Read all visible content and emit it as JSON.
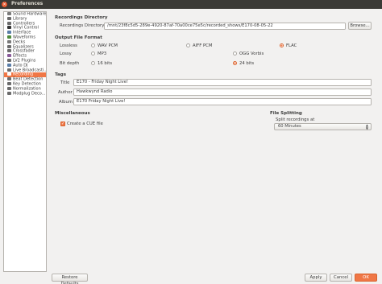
{
  "window": {
    "title": "Preferences"
  },
  "sidebar": {
    "items": [
      {
        "label": "Sound Hardware",
        "icon": "speaker-icon",
        "color": "#7a7a7a"
      },
      {
        "label": "Library",
        "icon": "library-icon",
        "color": "#6b6b6b"
      },
      {
        "label": "Controllers",
        "icon": "controller-icon",
        "color": "#6b6b6b"
      },
      {
        "label": "Vinyl Control",
        "icon": "vinyl-icon",
        "color": "#333333"
      },
      {
        "label": "Interface",
        "icon": "interface-icon",
        "color": "#5a7ea8"
      },
      {
        "label": "Waveforms",
        "icon": "waveform-icon",
        "color": "#4c8a3a"
      },
      {
        "label": "Decks",
        "icon": "deck-icon",
        "color": "#7a7a7a"
      },
      {
        "label": "Equalizers",
        "icon": "equalizer-icon",
        "color": "#6b6b6b"
      },
      {
        "label": "Crossfader",
        "icon": "crossfader-icon",
        "color": "#6b6b6b"
      },
      {
        "label": "Effects",
        "icon": "effects-icon",
        "color": "#8a5a9a"
      },
      {
        "label": "LV2 Plugins",
        "icon": "plugin-icon",
        "color": "#6b6b6b"
      },
      {
        "label": "Auto DJ",
        "icon": "autodj-icon",
        "color": "#5a7ea8"
      },
      {
        "label": "Live Broadcasti...",
        "icon": "broadcast-icon",
        "color": "#6b6b6b"
      },
      {
        "label": "Recording",
        "icon": "recording-icon",
        "color": "#ffffff",
        "selected": true
      },
      {
        "label": "Beat Detection",
        "icon": "beat-icon",
        "color": "#6b6b6b"
      },
      {
        "label": "Key Detection",
        "icon": "key-icon",
        "color": "#6b6b6b"
      },
      {
        "label": "Normalization",
        "icon": "normalization-icon",
        "color": "#6b6b6b"
      },
      {
        "label": "Modplug Deco...",
        "icon": "modplug-icon",
        "color": "#6b6b6b"
      }
    ]
  },
  "recordings_dir": {
    "title": "Recordings Directory",
    "label": "Recordings Directory:",
    "value": "/mnt/23f8c5d5-289e-4920-87af-70a00ce75e5c/recorded_shows/E170-08-05-22",
    "browse_label": "Browse..."
  },
  "output_format": {
    "title": "Output File Format",
    "lossless_label": "Lossless",
    "lossy_label": "Lossy",
    "bitdepth_label": "Bit depth",
    "options": {
      "wav": {
        "label": "WAV PCM",
        "checked": false
      },
      "aiff": {
        "label": "AIFF PCM",
        "checked": false
      },
      "flac": {
        "label": "FLAC",
        "checked": true
      },
      "mp3": {
        "label": "MP3",
        "checked": false
      },
      "ogg": {
        "label": "OGG Vorbis",
        "checked": false
      },
      "bits16": {
        "label": "16 bits",
        "checked": false
      },
      "bits24": {
        "label": "24 bits",
        "checked": true
      }
    }
  },
  "tags": {
    "title": "Tags",
    "title_label": "Title",
    "title_value": "E170 - Friday Night Live!",
    "author_label": "Author",
    "author_value": "Hawkwynd Radio",
    "album_label": "Album",
    "album_value": "E170 Friday Night Live!"
  },
  "misc": {
    "title": "Miscellaneous",
    "cue_label": "Create a CUE file",
    "cue_checked": true
  },
  "file_split": {
    "title": "File Splitting",
    "label": "Split recordings at",
    "value": "60 Minutes"
  },
  "buttons": {
    "restore": "Restore Defaults",
    "apply": "Apply",
    "cancel": "Cancel",
    "ok": "OK"
  },
  "colors": {
    "accent": "#f07746",
    "titlebar": "#3b3a36",
    "close": "#e9582e"
  }
}
